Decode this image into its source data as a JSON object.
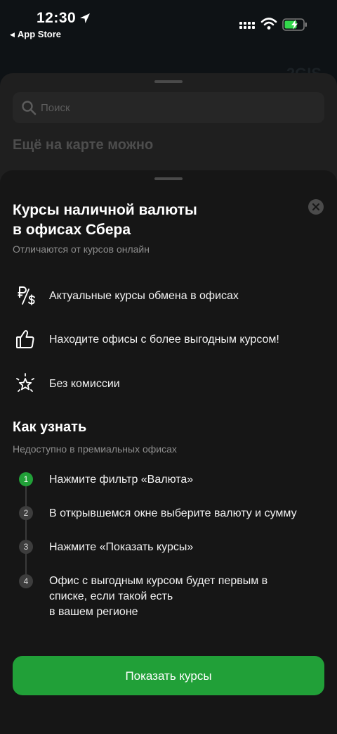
{
  "status_bar": {
    "time": "12:30",
    "back_app": "App Store"
  },
  "background": {
    "brand_text": "2GIS",
    "search_placeholder": "Поиск",
    "heading": "Ещё на карте можно"
  },
  "sheet": {
    "title_line1": "Курсы наличной валюты",
    "title_line2": "в офисах Сбера",
    "subtitle": "Отличаются от курсов онлайн",
    "features": [
      {
        "icon": "ruble-dollar-icon",
        "text": "Актуальные курсы обмена в офисах"
      },
      {
        "icon": "thumbs-up-icon",
        "text": "Находите офисы с более выгодным курсом!"
      },
      {
        "icon": "sparkle-star-icon",
        "text": "Без комиссии"
      }
    ],
    "how_title": "Как узнать",
    "how_subtitle": "Недоступно в премиальных офисах",
    "steps": [
      {
        "num": "1",
        "lines": [
          "Нажмите фильтр «Валюта»"
        ]
      },
      {
        "num": "2",
        "lines": [
          "В открывшемся окне выберите валюту и сумму"
        ]
      },
      {
        "num": "3",
        "lines": [
          "Нажмите «Показать курсы»"
        ]
      },
      {
        "num": "4",
        "lines": [
          "Офис с выгодным курсом будет первым в",
          "списке, если такой есть",
          "в вашем регионе"
        ]
      }
    ],
    "cta_label": "Показать курсы"
  },
  "colors": {
    "accent": "#21a038",
    "sheet_bg": "#161616",
    "text_muted": "#8d8d8d"
  }
}
